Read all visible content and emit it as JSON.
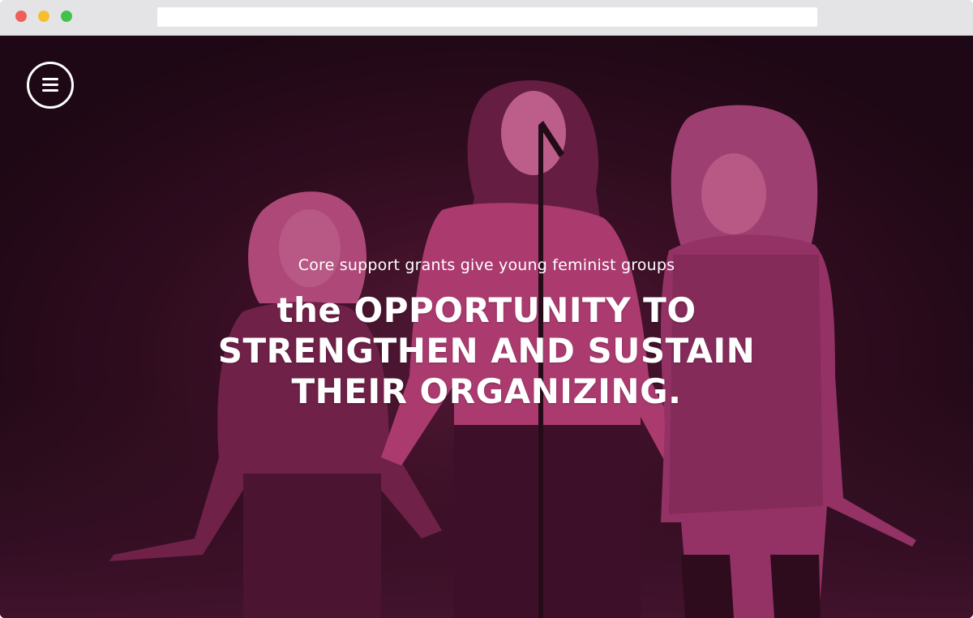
{
  "browser": {
    "address_value": ""
  },
  "hero": {
    "subtitle": "Core support grants give young feminist groups",
    "headline": "the OPPORTUNITY TO STRENGTHEN AND SUSTAIN THEIR ORGANIZING."
  },
  "menu": {
    "icon": "hamburger-menu-icon"
  },
  "colors": {
    "overlay_magenta": "#c2457e",
    "background_dark": "#1a0711",
    "text": "#ffffff"
  }
}
